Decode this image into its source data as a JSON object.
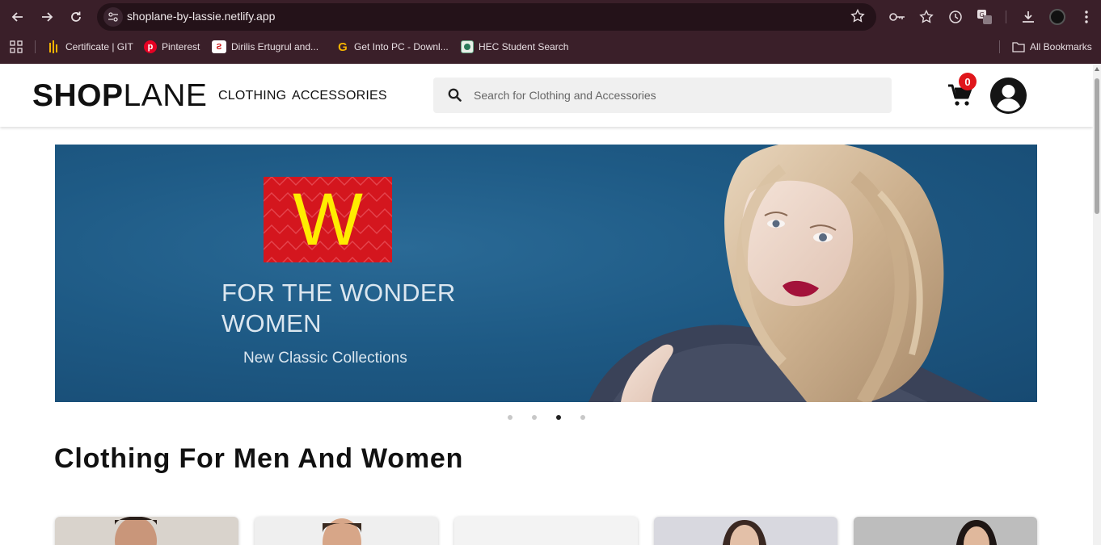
{
  "browser": {
    "url": "shoplane-by-lassie.netlify.app",
    "bookmarks": [
      {
        "label": "Certificate | GIT",
        "icon": "git-bars-icon"
      },
      {
        "label": "Pinterest",
        "icon": "pinterest-icon"
      },
      {
        "label": "Dirilis Ertugrul and...",
        "icon": "ertugrul-site-icon"
      },
      {
        "label": "Get Into PC - Downl...",
        "icon": "getintopc-icon"
      },
      {
        "label": "HEC Student Search",
        "icon": "hec-icon"
      }
    ],
    "all_bookmarks_label": "All Bookmarks"
  },
  "header": {
    "logo_bold": "SHOP",
    "logo_light": "LANE",
    "nav": [
      "CLOTHING",
      "ACCESSORIES"
    ],
    "search_placeholder": "Search for Clothing and Accessories",
    "cart_count": "0"
  },
  "banner": {
    "brand_letter": "W",
    "title_line1": "FOR THE WONDER",
    "title_line2": "WOMEN",
    "subtitle": "New Classic Collections",
    "slide_count": 4,
    "active_slide": 3,
    "colors": {
      "background": "#1e5a85",
      "brand_box": "#d4161e",
      "brand_letter": "#ffec00"
    }
  },
  "section": {
    "title": "Clothing For Men And Women",
    "product_cards": 5
  }
}
